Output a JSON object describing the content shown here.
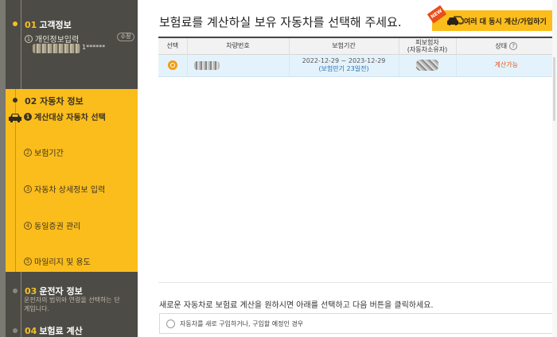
{
  "sidebar": {
    "step1": {
      "num": "01",
      "title": "고객정보",
      "sub": "개인정보입력",
      "edit": "수정",
      "masked_suffix": "1******"
    },
    "step2": {
      "num": "02",
      "title": "자동차 정보",
      "items": [
        {
          "num": "1",
          "label": "계산대상 자동차 선택"
        },
        {
          "num": "2",
          "label": "보험기간"
        },
        {
          "num": "3",
          "label": "자동차 상세정보 입력"
        },
        {
          "num": "4",
          "label": "동일증권 관리"
        },
        {
          "num": "5",
          "label": "마일리지 및 용도"
        }
      ]
    },
    "step3": {
      "num": "03",
      "title": "운전자 정보",
      "desc": "운전자의 범위와 연령을 선택하는 단계입니다."
    },
    "step4": {
      "num": "04",
      "title": "보험료 계산"
    }
  },
  "main": {
    "heading": "보험료를 계산하실 보유 자동차를 선택해 주세요.",
    "multi_button": {
      "badge": "NEW",
      "label": "여러 대 동시 계산/가입하기"
    },
    "table": {
      "headers": {
        "select": "선택",
        "plate": "차량번호",
        "period": "보험기간",
        "insured_line1": "피보험자",
        "insured_line2": "(자동차소유자)",
        "status": "상태"
      },
      "rows": [
        {
          "period": "2022-12-29 ~ 2023-12-29",
          "remain": "(보험만기 23일전)",
          "status": "계산가능"
        }
      ]
    },
    "notice": "새로운 자동차로 보험료 계산을 원하시면 아래를 선택하고 다음 버튼을 클릭하세요.",
    "new_car_option": "자동차를 새로 구입하거나, 구입할 예정인 경우"
  },
  "colors": {
    "accent": "#fbbd1c",
    "sidebar": "#4d4b45",
    "status": "#e2571c",
    "selected_row": "#e4f3fb"
  }
}
